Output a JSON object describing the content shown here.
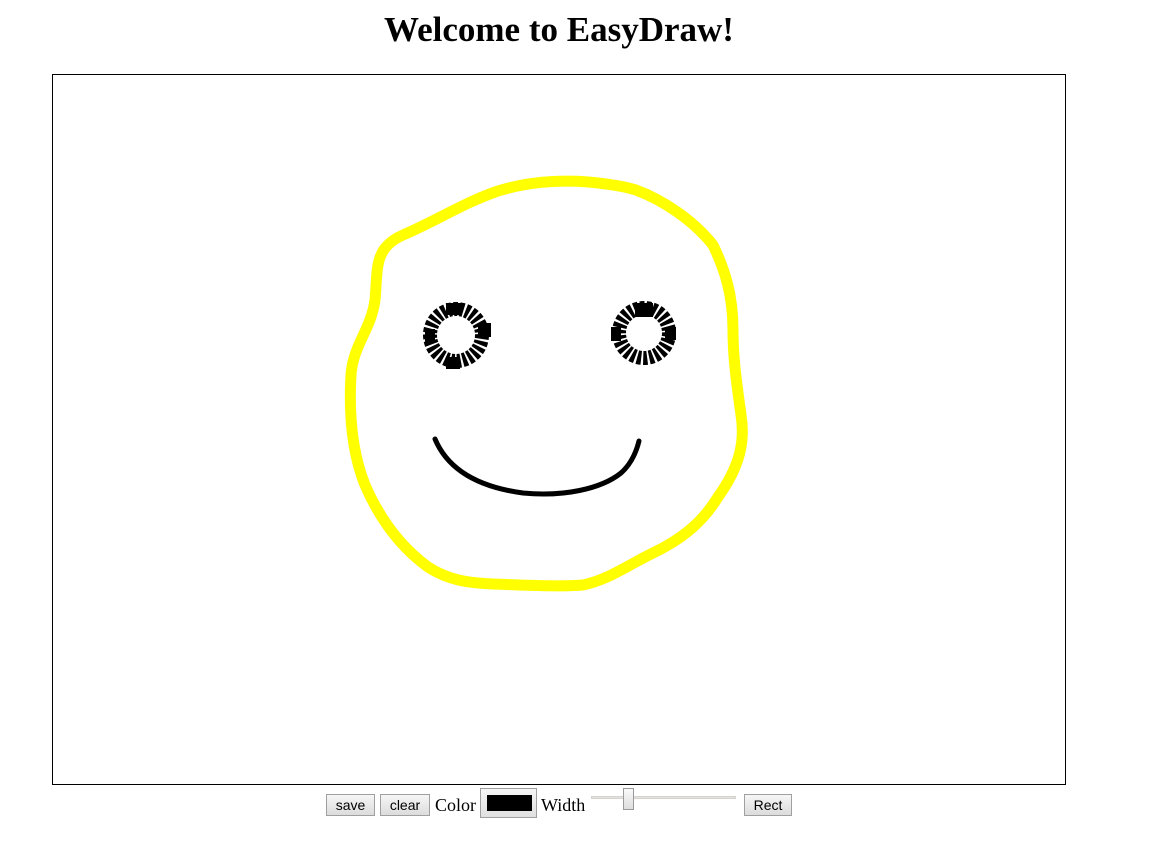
{
  "page": {
    "title": "Welcome to EasyDraw!"
  },
  "canvas": {
    "strokes": [
      {
        "name": "head-outline",
        "color": "#ffff00"
      },
      {
        "name": "left-eye",
        "color": "#000000"
      },
      {
        "name": "right-eye",
        "color": "#000000"
      },
      {
        "name": "smile",
        "color": "#000000"
      }
    ]
  },
  "toolbar": {
    "save_label": "save",
    "clear_label": "clear",
    "color_label": "Color",
    "color_value": "#000000",
    "width_label": "Width",
    "width_value_fraction": 0.24,
    "rect_label": "Rect"
  }
}
